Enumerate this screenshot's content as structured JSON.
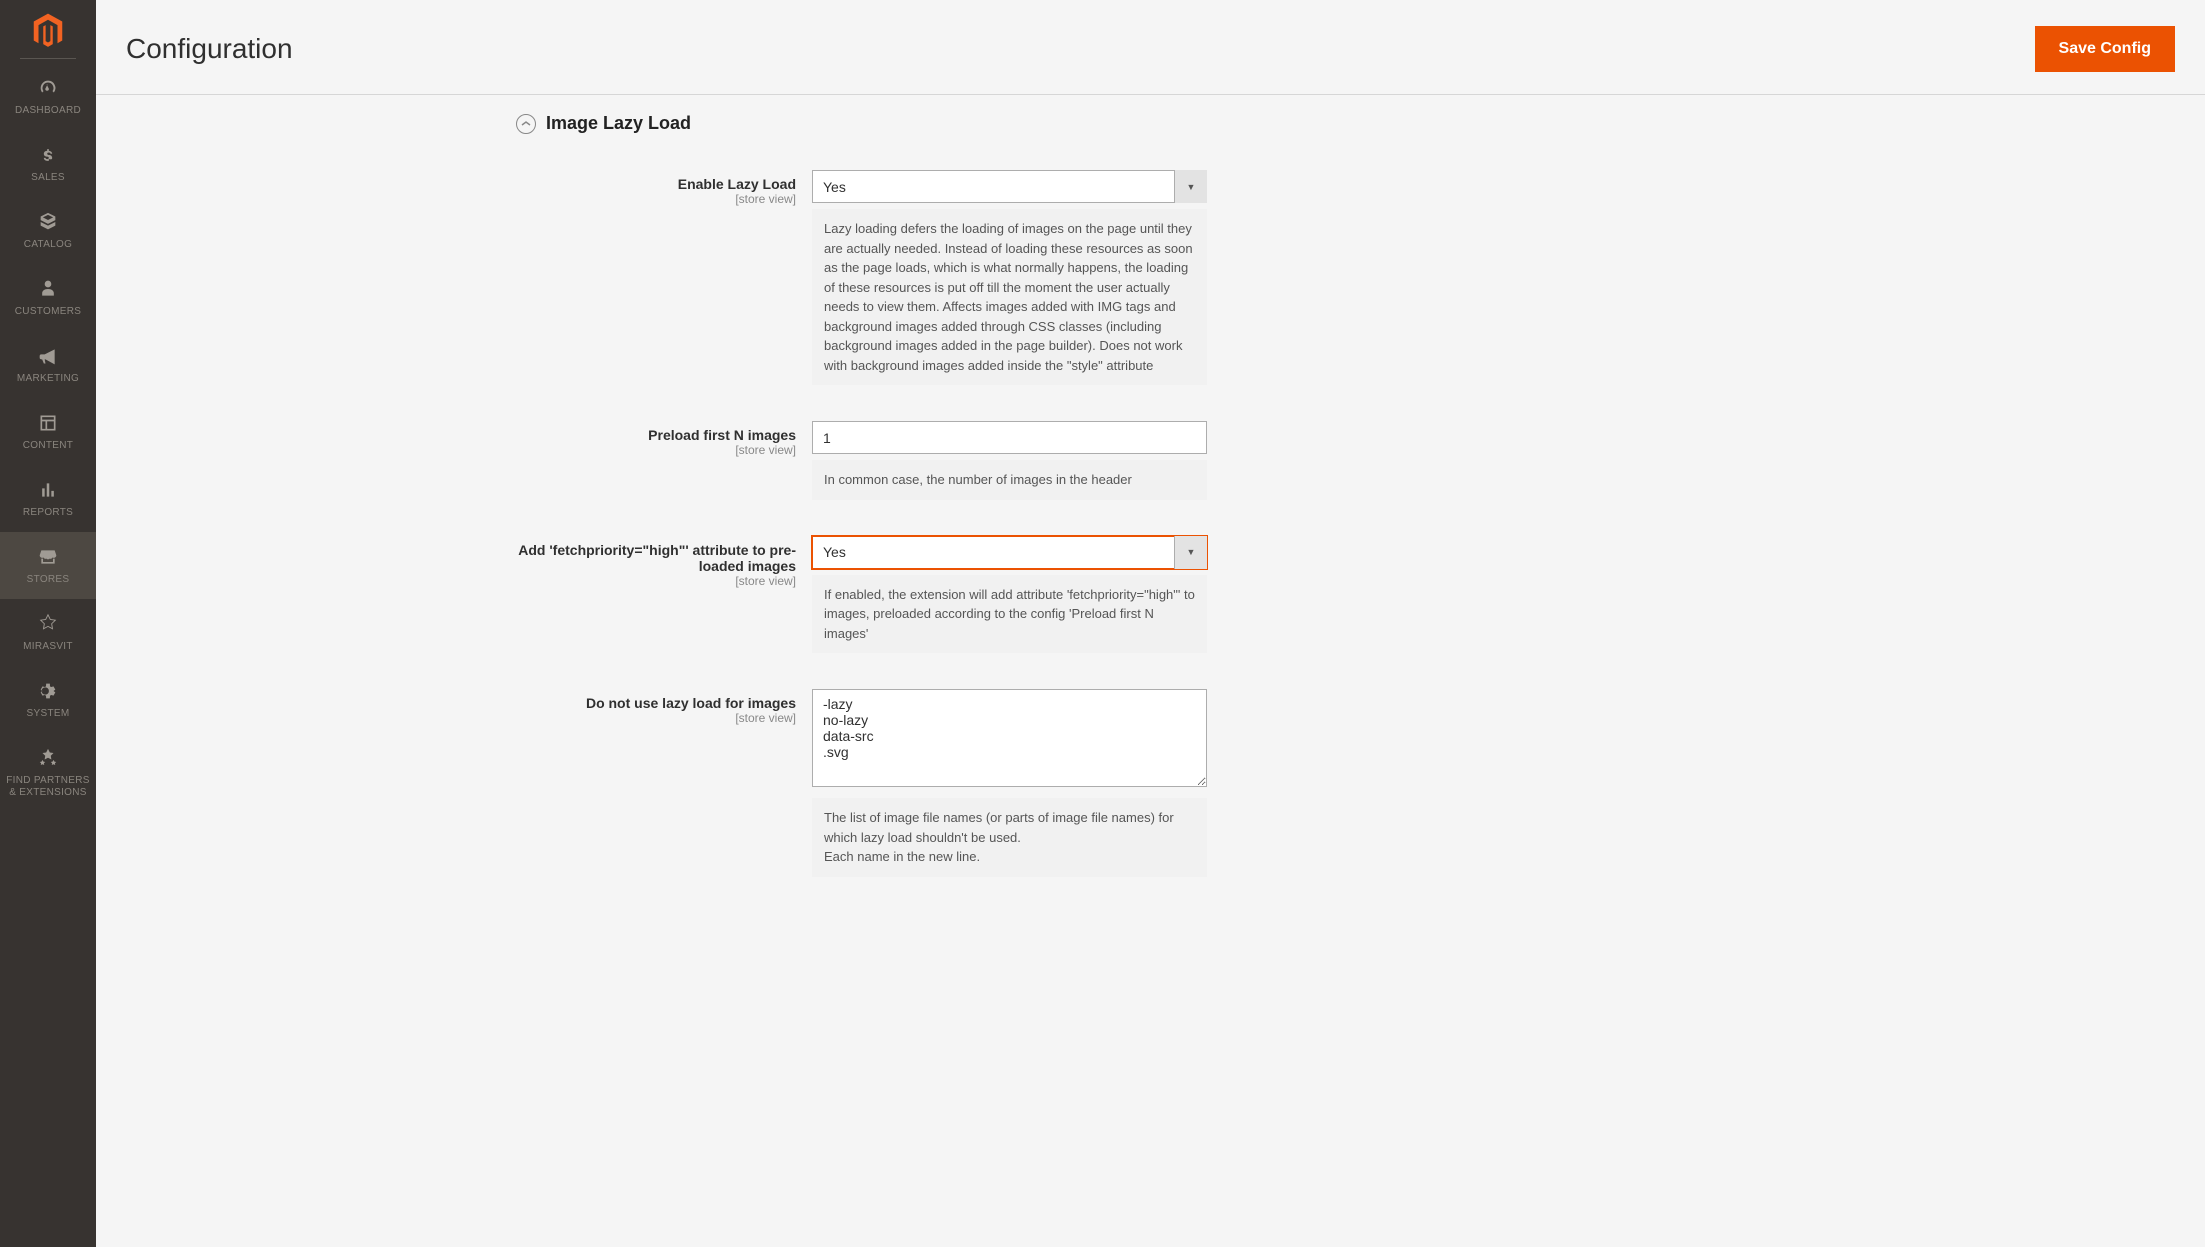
{
  "header": {
    "page_title": "Configuration",
    "save_button": "Save Config"
  },
  "sidebar": {
    "items": [
      {
        "label": "DASHBOARD",
        "icon": "dashboard"
      },
      {
        "label": "SALES",
        "icon": "dollar"
      },
      {
        "label": "CATALOG",
        "icon": "catalog"
      },
      {
        "label": "CUSTOMERS",
        "icon": "customers"
      },
      {
        "label": "MARKETING",
        "icon": "marketing"
      },
      {
        "label": "CONTENT",
        "icon": "content"
      },
      {
        "label": "REPORTS",
        "icon": "reports"
      },
      {
        "label": "STORES",
        "icon": "stores"
      },
      {
        "label": "MIRASVIT",
        "icon": "mirasvit"
      },
      {
        "label": "SYSTEM",
        "icon": "system"
      },
      {
        "label": "FIND PARTNERS & EXTENSIONS",
        "icon": "partners"
      }
    ]
  },
  "section": {
    "title": "Image Lazy Load",
    "scope_label": "[store view]"
  },
  "fields": {
    "enable": {
      "label": "Enable Lazy Load",
      "value": "Yes",
      "note": "Lazy loading defers the loading of images on the page until they are actually needed. Instead of loading these resources as soon as the page loads, which is what normally happens, the loading of these resources is put off till the moment the user actually needs to view them. Affects images added with IMG tags and background images added through CSS classes (including background images added in the page builder). Does not work with background images added inside the \"style\" attribute"
    },
    "preload": {
      "label": "Preload first N images",
      "value": "1",
      "note": "In common case, the number of images in the header"
    },
    "fetchpriority": {
      "label": "Add 'fetchpriority=\"high\"' attribute to pre-loaded images",
      "value": "Yes",
      "note": "If enabled, the extension will add attribute 'fetchpriority=\"high\"' to images, preloaded according to the config 'Preload first N images'"
    },
    "exclude": {
      "label": "Do not use lazy load for images",
      "value": "-lazy\nno-lazy\ndata-src\n.svg",
      "note": "The list of image file names (or parts of image file names) for which lazy load shouldn't be used.\nEach name in the new line."
    }
  }
}
